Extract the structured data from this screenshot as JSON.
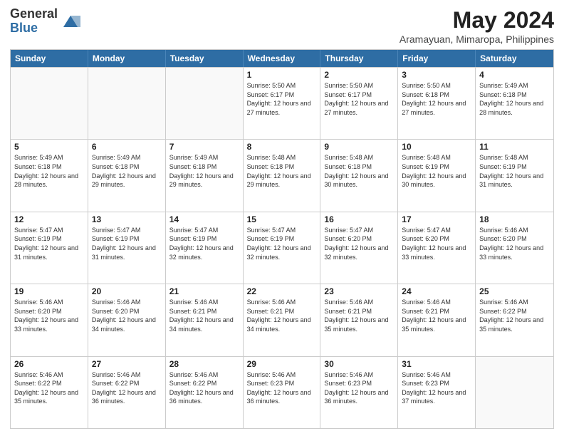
{
  "header": {
    "logo_line1": "General",
    "logo_line2": "Blue",
    "main_title": "May 2024",
    "subtitle": "Aramayuan, Mimaropa, Philippines"
  },
  "calendar": {
    "days_of_week": [
      "Sunday",
      "Monday",
      "Tuesday",
      "Wednesday",
      "Thursday",
      "Friday",
      "Saturday"
    ],
    "rows": [
      [
        {
          "day": "",
          "info": ""
        },
        {
          "day": "",
          "info": ""
        },
        {
          "day": "",
          "info": ""
        },
        {
          "day": "1",
          "info": "Sunrise: 5:50 AM\nSunset: 6:17 PM\nDaylight: 12 hours and 27 minutes."
        },
        {
          "day": "2",
          "info": "Sunrise: 5:50 AM\nSunset: 6:17 PM\nDaylight: 12 hours and 27 minutes."
        },
        {
          "day": "3",
          "info": "Sunrise: 5:50 AM\nSunset: 6:18 PM\nDaylight: 12 hours and 27 minutes."
        },
        {
          "day": "4",
          "info": "Sunrise: 5:49 AM\nSunset: 6:18 PM\nDaylight: 12 hours and 28 minutes."
        }
      ],
      [
        {
          "day": "5",
          "info": "Sunrise: 5:49 AM\nSunset: 6:18 PM\nDaylight: 12 hours and 28 minutes."
        },
        {
          "day": "6",
          "info": "Sunrise: 5:49 AM\nSunset: 6:18 PM\nDaylight: 12 hours and 29 minutes."
        },
        {
          "day": "7",
          "info": "Sunrise: 5:49 AM\nSunset: 6:18 PM\nDaylight: 12 hours and 29 minutes."
        },
        {
          "day": "8",
          "info": "Sunrise: 5:48 AM\nSunset: 6:18 PM\nDaylight: 12 hours and 29 minutes."
        },
        {
          "day": "9",
          "info": "Sunrise: 5:48 AM\nSunset: 6:18 PM\nDaylight: 12 hours and 30 minutes."
        },
        {
          "day": "10",
          "info": "Sunrise: 5:48 AM\nSunset: 6:19 PM\nDaylight: 12 hours and 30 minutes."
        },
        {
          "day": "11",
          "info": "Sunrise: 5:48 AM\nSunset: 6:19 PM\nDaylight: 12 hours and 31 minutes."
        }
      ],
      [
        {
          "day": "12",
          "info": "Sunrise: 5:47 AM\nSunset: 6:19 PM\nDaylight: 12 hours and 31 minutes."
        },
        {
          "day": "13",
          "info": "Sunrise: 5:47 AM\nSunset: 6:19 PM\nDaylight: 12 hours and 31 minutes."
        },
        {
          "day": "14",
          "info": "Sunrise: 5:47 AM\nSunset: 6:19 PM\nDaylight: 12 hours and 32 minutes."
        },
        {
          "day": "15",
          "info": "Sunrise: 5:47 AM\nSunset: 6:19 PM\nDaylight: 12 hours and 32 minutes."
        },
        {
          "day": "16",
          "info": "Sunrise: 5:47 AM\nSunset: 6:20 PM\nDaylight: 12 hours and 32 minutes."
        },
        {
          "day": "17",
          "info": "Sunrise: 5:47 AM\nSunset: 6:20 PM\nDaylight: 12 hours and 33 minutes."
        },
        {
          "day": "18",
          "info": "Sunrise: 5:46 AM\nSunset: 6:20 PM\nDaylight: 12 hours and 33 minutes."
        }
      ],
      [
        {
          "day": "19",
          "info": "Sunrise: 5:46 AM\nSunset: 6:20 PM\nDaylight: 12 hours and 33 minutes."
        },
        {
          "day": "20",
          "info": "Sunrise: 5:46 AM\nSunset: 6:20 PM\nDaylight: 12 hours and 34 minutes."
        },
        {
          "day": "21",
          "info": "Sunrise: 5:46 AM\nSunset: 6:21 PM\nDaylight: 12 hours and 34 minutes."
        },
        {
          "day": "22",
          "info": "Sunrise: 5:46 AM\nSunset: 6:21 PM\nDaylight: 12 hours and 34 minutes."
        },
        {
          "day": "23",
          "info": "Sunrise: 5:46 AM\nSunset: 6:21 PM\nDaylight: 12 hours and 35 minutes."
        },
        {
          "day": "24",
          "info": "Sunrise: 5:46 AM\nSunset: 6:21 PM\nDaylight: 12 hours and 35 minutes."
        },
        {
          "day": "25",
          "info": "Sunrise: 5:46 AM\nSunset: 6:22 PM\nDaylight: 12 hours and 35 minutes."
        }
      ],
      [
        {
          "day": "26",
          "info": "Sunrise: 5:46 AM\nSunset: 6:22 PM\nDaylight: 12 hours and 35 minutes."
        },
        {
          "day": "27",
          "info": "Sunrise: 5:46 AM\nSunset: 6:22 PM\nDaylight: 12 hours and 36 minutes."
        },
        {
          "day": "28",
          "info": "Sunrise: 5:46 AM\nSunset: 6:22 PM\nDaylight: 12 hours and 36 minutes."
        },
        {
          "day": "29",
          "info": "Sunrise: 5:46 AM\nSunset: 6:23 PM\nDaylight: 12 hours and 36 minutes."
        },
        {
          "day": "30",
          "info": "Sunrise: 5:46 AM\nSunset: 6:23 PM\nDaylight: 12 hours and 36 minutes."
        },
        {
          "day": "31",
          "info": "Sunrise: 5:46 AM\nSunset: 6:23 PM\nDaylight: 12 hours and 37 minutes."
        },
        {
          "day": "",
          "info": ""
        }
      ]
    ]
  }
}
